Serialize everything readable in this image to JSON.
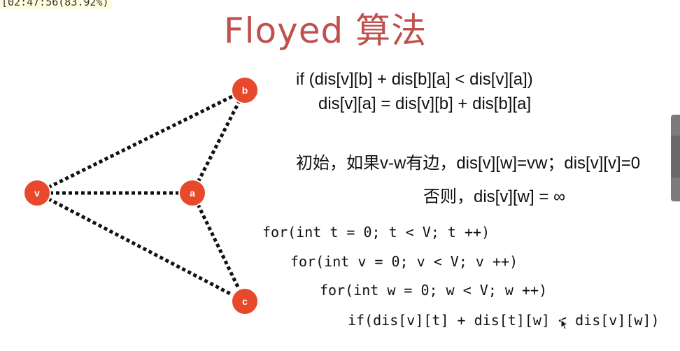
{
  "overlay": {
    "timestamp": "[02:47:56(83.92%)"
  },
  "slide": {
    "title": "Floyed 算法",
    "formula": [
      "if (dis[v][b] + dis[b][a] < dis[v][a])",
      "dis[v][a] = dis[v][b] + dis[b][a]"
    ],
    "init": [
      "初始，如果v-w有边，dis[v][w]=vw；dis[v][v]=0",
      "否则，dis[v][w] = ∞"
    ],
    "code": [
      "for(int t = 0; t < V; t ++)",
      "for(int v = 0; v < V; v ++)",
      "for(int w = 0; w < V; w ++)",
      "if(dis[v][t] + dis[t][w] < dis[v][w])"
    ]
  },
  "graph": {
    "nodes": [
      "v",
      "b",
      "a",
      "c"
    ],
    "node_color": "#e8482c",
    "edge_color": "#111111"
  },
  "colors": {
    "title": "#c0504d",
    "node": "#e8482c",
    "handle": "#7b7b7b"
  }
}
